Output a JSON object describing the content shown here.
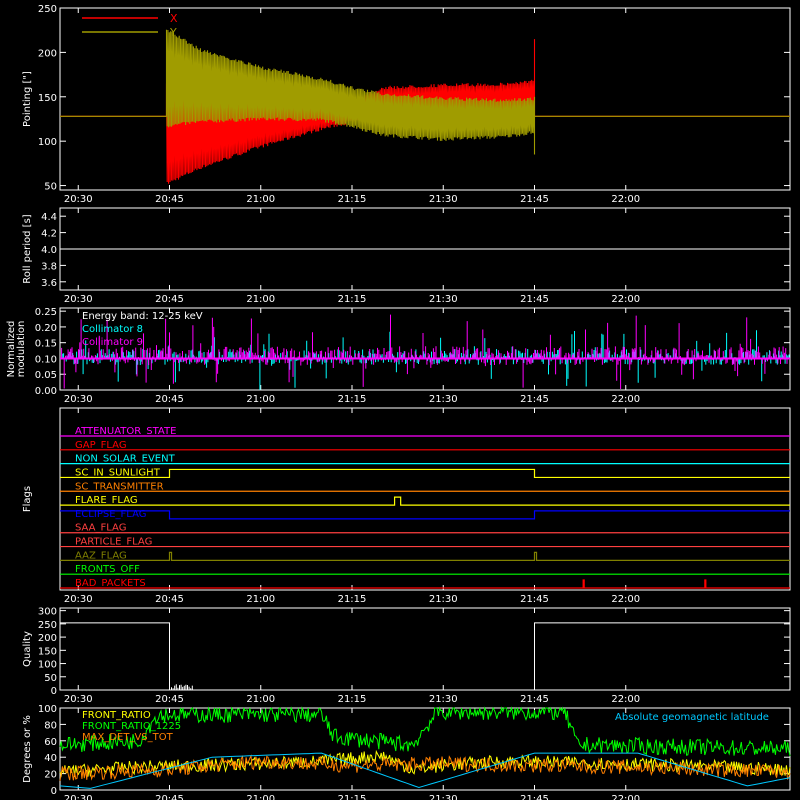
{
  "chart_data": [
    {
      "id": "pointing",
      "type": "line",
      "ylabel": "Pointing [\"]",
      "ylim": [
        45,
        250
      ],
      "yticks": [
        50,
        100,
        150,
        200,
        250
      ],
      "xlim": [
        "20:27",
        "22:27"
      ],
      "xticks": [
        "20:30",
        "20:45",
        "21:00",
        "21:15",
        "21:30",
        "21:45",
        "22:00"
      ],
      "series": [
        {
          "name": "X",
          "color": "#ff0000",
          "baseline": 128,
          "active_from": "20:44:30",
          "active_to": "21:45:00",
          "x": [
            "20:44:30",
            "20:50",
            "21:00",
            "21:10",
            "21:15",
            "21:20",
            "21:30",
            "21:40",
            "21:45"
          ],
          "y_low": [
            50,
            68,
            92,
            112,
            120,
            125,
            128,
            132,
            133
          ],
          "y_high": [
            165,
            154,
            145,
            145,
            147,
            162,
            165,
            166,
            170
          ]
        },
        {
          "name": "Y",
          "color": "#a09c00",
          "baseline": 128,
          "active_from": "20:44:30",
          "active_to": "21:45:00",
          "x": [
            "20:44:30",
            "20:50",
            "21:00",
            "21:10",
            "21:15",
            "21:20",
            "21:30",
            "21:40",
            "21:45"
          ],
          "y_low": [
            115,
            120,
            123,
            122,
            115,
            105,
            100,
            103,
            108
          ],
          "y_high": [
            228,
            205,
            185,
            172,
            162,
            155,
            150,
            148,
            150
          ]
        }
      ]
    },
    {
      "id": "roll",
      "type": "line",
      "ylabel": "Roll period [s]",
      "ylim": [
        3.5,
        4.5
      ],
      "yticks": [
        3.6,
        3.8,
        4.0,
        4.2,
        4.4
      ],
      "ytick_labels": [
        "3.6",
        "3.8",
        "4.0",
        "4.2",
        "4.4"
      ],
      "xticks": [
        "20:30",
        "20:45",
        "21:00",
        "21:15",
        "21:30",
        "21:45",
        "22:00"
      ],
      "series": [
        {
          "name": "",
          "color": "#ffffff",
          "x": [
            "20:27",
            "22:27"
          ],
          "y": [
            4.0,
            4.0
          ]
        }
      ]
    },
    {
      "id": "modulation",
      "type": "line",
      "ylabel": "Normalized modulation",
      "ylim": [
        0,
        0.26
      ],
      "yticks": [
        0.0,
        0.05,
        0.1,
        0.15,
        0.2,
        0.25
      ],
      "ytick_labels": [
        "0.00",
        "0.05",
        "0.10",
        "0.15",
        "0.20",
        "0.25"
      ],
      "xticks": [
        "20:30",
        "20:45",
        "21:00",
        "21:15",
        "21:30",
        "21:45",
        "22:00"
      ],
      "annotation": "Energy band: 12-25 keV",
      "series": [
        {
          "name": "Collimator 8",
          "color": "#00ffff",
          "baseline": 0.1
        },
        {
          "name": "Collimator 9",
          "color": "#ff00ff",
          "baseline": 0.1
        }
      ]
    },
    {
      "id": "flags",
      "type": "line",
      "ylabel": "Flags",
      "xticks": [
        "20:30",
        "20:45",
        "21:00",
        "21:15",
        "21:30",
        "21:45",
        "22:00"
      ],
      "flags": [
        {
          "label": "ATTENUATOR_STATE",
          "color": "#ff00ff",
          "events": [],
          "inverted": false
        },
        {
          "label": "GAP_FLAG",
          "color": "#ff0000",
          "events": [],
          "inverted": false
        },
        {
          "label": "NON_SOLAR_EVENT",
          "color": "#00ffff",
          "events": [],
          "inverted": false
        },
        {
          "label": "SC_IN_SUNLIGHT",
          "color": "#ffff00",
          "events": [
            [
              "20:45",
              "21:45"
            ]
          ],
          "inverted": false
        },
        {
          "label": "SC_TRANSMITTER",
          "color": "#ff8000",
          "events": [],
          "inverted": false
        },
        {
          "label": "FLARE_FLAG",
          "color": "#ffff00",
          "events": [
            [
              "21:22",
              "21:23"
            ]
          ],
          "inverted": false
        },
        {
          "label": "ECLIPSE_FLAG",
          "color": "#0000ff",
          "events": [
            [
              "20:45",
              "21:45"
            ]
          ],
          "inverted": true
        },
        {
          "label": "SAA_FLAG",
          "color": "#ff4040",
          "events": [],
          "inverted": false
        },
        {
          "label": "PARTICLE_FLAG",
          "color": "#ff4040",
          "events": [],
          "inverted": false
        },
        {
          "label": "AAZ_FLAG",
          "color": "#808000",
          "events": [
            [
              "20:45",
              "20:45:20"
            ],
            [
              "21:45",
              "21:45:20"
            ]
          ],
          "inverted": false
        },
        {
          "label": "FRONTS_OFF",
          "color": "#00ff00",
          "events": [],
          "inverted": false
        },
        {
          "label": "BAD_PACKETS",
          "color": "#ff0000",
          "events": [
            [
              "21:53",
              "21:53:10"
            ],
            [
              "22:13",
              "22:13:10"
            ]
          ],
          "inverted": false
        }
      ]
    },
    {
      "id": "quality",
      "type": "line",
      "ylabel": "Quality",
      "ylim": [
        0,
        310
      ],
      "yticks": [
        0,
        50,
        100,
        150,
        200,
        250,
        300
      ],
      "xticks": [
        "20:30",
        "20:45",
        "21:00",
        "21:15",
        "21:30",
        "21:45",
        "22:00"
      ],
      "series": [
        {
          "name": "",
          "color": "#ffffff",
          "x": [
            "20:27",
            "20:45",
            "20:45",
            "21:45",
            "21:45",
            "22:27"
          ],
          "y": [
            254,
            254,
            0,
            0,
            254,
            254
          ]
        }
      ]
    },
    {
      "id": "ratios",
      "type": "line",
      "ylabel": "Degrees or %",
      "ylim": [
        0,
        100
      ],
      "yticks": [
        0,
        20,
        40,
        60,
        80,
        100
      ],
      "xticks": [
        "20:30",
        "20:45",
        "21:00",
        "21:15",
        "21:30",
        "21:45",
        "22:00"
      ],
      "annotation": "Absolute geomagnetic latitude",
      "series": [
        {
          "name": "FRONT_RATIO",
          "color": "#ffff00",
          "x": [
            "20:27",
            "20:40",
            "21:00",
            "21:10",
            "21:20",
            "21:25",
            "21:30",
            "21:40",
            "22:00",
            "22:27"
          ],
          "y": [
            22,
            28,
            32,
            35,
            42,
            25,
            30,
            35,
            32,
            25
          ]
        },
        {
          "name": "FRONT_RATIO_1225",
          "color": "#00ff00",
          "x": [
            "20:27",
            "20:40",
            "20:43",
            "21:10",
            "21:12",
            "21:25",
            "21:29",
            "21:50",
            "21:52",
            "22:27"
          ],
          "y": [
            55,
            60,
            92,
            92,
            65,
            55,
            95,
            95,
            55,
            50
          ]
        },
        {
          "name": "MAX_DET_VS_TOT",
          "color": "#ff8000",
          "x": [
            "20:27",
            "20:45",
            "21:00",
            "21:15",
            "21:30",
            "21:45",
            "22:00",
            "22:27"
          ],
          "y": [
            20,
            25,
            35,
            30,
            32,
            30,
            28,
            22
          ]
        },
        {
          "name": "Absolute geomagnetic latitude",
          "color": "#00c8ff",
          "x": [
            "20:27",
            "20:32",
            "20:52",
            "21:10",
            "21:26",
            "21:45",
            "22:02",
            "22:20",
            "22:27"
          ],
          "y": [
            5,
            2,
            40,
            45,
            3,
            45,
            45,
            5,
            15
          ]
        }
      ]
    }
  ]
}
